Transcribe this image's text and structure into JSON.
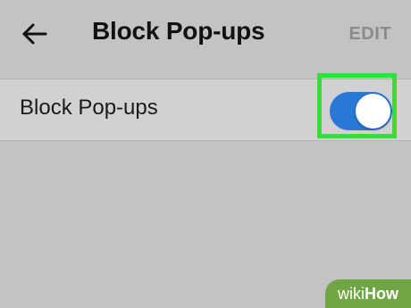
{
  "header": {
    "title": "Block Pop-ups",
    "edit_label": "EDIT",
    "back_icon": "back-arrow-icon"
  },
  "setting": {
    "label": "Block Pop-ups",
    "toggle_state": "on"
  },
  "colors": {
    "background": "#c3c3c5",
    "row_background": "#d1d1d3",
    "toggle_on": "#2a78d6",
    "highlight": "#32e132",
    "edit_text": "#8a8a8d"
  },
  "watermark": {
    "prefix": "wiki",
    "suffix": "How"
  }
}
